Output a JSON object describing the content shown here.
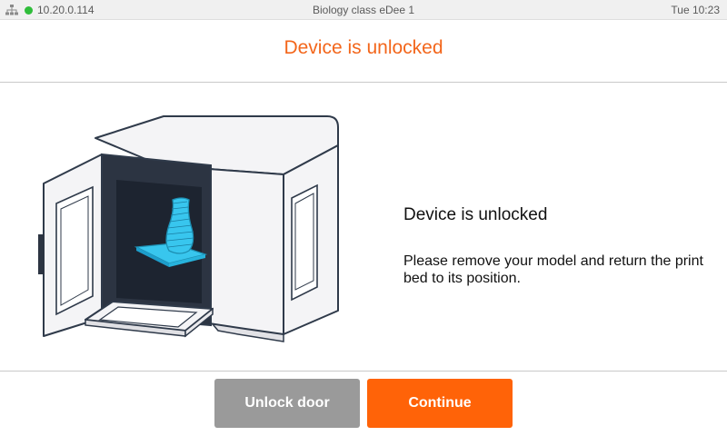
{
  "status_bar": {
    "network_icon": "network-icon",
    "connection_status_color": "#2fbd3a",
    "ip_address": "10.20.0.114",
    "device_name": "Biology class eDee 1",
    "datetime": "Tue 10:23"
  },
  "header": {
    "title": "Device is unlocked",
    "title_color": "#f3661b"
  },
  "main": {
    "illustration": "printer-open-door-illustration",
    "heading": "Device is unlocked",
    "body": "Please remove your model and return the print bed to its position."
  },
  "footer": {
    "unlock_label": "Unlock door",
    "continue_label": "Continue",
    "unlock_color": "#9a9a9a",
    "continue_color": "#ff6308"
  }
}
